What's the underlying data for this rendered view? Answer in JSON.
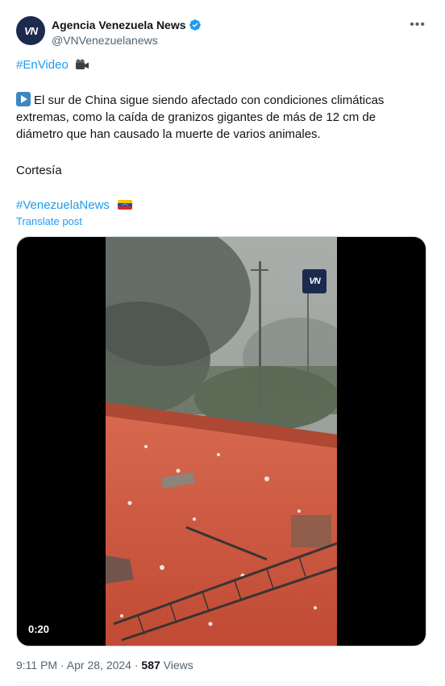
{
  "author": {
    "display_name": "Agencia Venezuela News",
    "handle": "@VNVenezuelanews",
    "avatar_text": "VN"
  },
  "tweet": {
    "hashtag_1": "#EnVideo",
    "text_line_1": "El sur de China sigue siendo afectado con condiciones climáticas",
    "text_line_2": "extremas, como la caída de granizos gigantes de más de 12 cm de",
    "text_line_3": "diámetro que han causado la muerte de varios animales.",
    "credit": "Cortesía",
    "hashtag_2": "#VenezuelaNews",
    "translate_label": "Translate post"
  },
  "media": {
    "watermark_text": "VN",
    "duration": "0:20"
  },
  "meta": {
    "time": "9:11 PM",
    "separator": "·",
    "date": "Apr 28, 2024",
    "views_count": "587",
    "views_label": "Views"
  },
  "icons": {
    "verified": "verified-badge-icon",
    "more": "more-options-icon",
    "play": "play-button-emoji-icon",
    "camera": "movie-camera-emoji-icon",
    "flag": "venezuela-flag-icon"
  },
  "colors": {
    "link": "#1d9bf0",
    "text": "#0f1419",
    "secondary": "#536471",
    "roof": "#c8523b"
  }
}
